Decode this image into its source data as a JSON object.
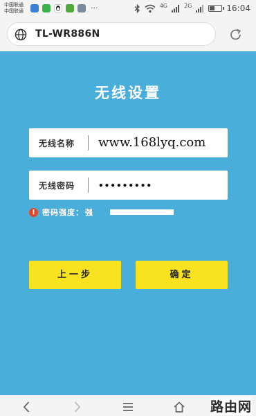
{
  "status_bar": {
    "carrier_line1": "中国联通",
    "carrier_line2": "中国联通",
    "more": "···",
    "net_4g": "4G",
    "net_2g": "2G",
    "battery_level": 0.45,
    "time": "16:04",
    "app_icons": [
      {
        "name": "app-icon-blue",
        "color": "#3b7fd6"
      },
      {
        "name": "app-icon-green",
        "color": "#3cb34a"
      },
      {
        "name": "qq-icon",
        "color": "#222222"
      },
      {
        "name": "app-icon-green2",
        "color": "#52a83c"
      },
      {
        "name": "app-icon-gray",
        "color": "#7a8a9a"
      }
    ]
  },
  "address_bar": {
    "url": "TL-WR886N"
  },
  "page": {
    "title": "无线设置",
    "ssid_label": "无线名称",
    "ssid_value": "www.168lyq.com",
    "password_label": "无线密码",
    "password_value": "•••••••••",
    "strength_label": "密码强度：",
    "strength_value": "强",
    "strength_level": 1.0,
    "prev_button": "上一步",
    "confirm_button": "确定"
  },
  "colors": {
    "background": "#4aaedb",
    "button": "#f9e21f",
    "warning": "#e8462a"
  },
  "bottom_bar": {
    "watermark": "路由网"
  }
}
